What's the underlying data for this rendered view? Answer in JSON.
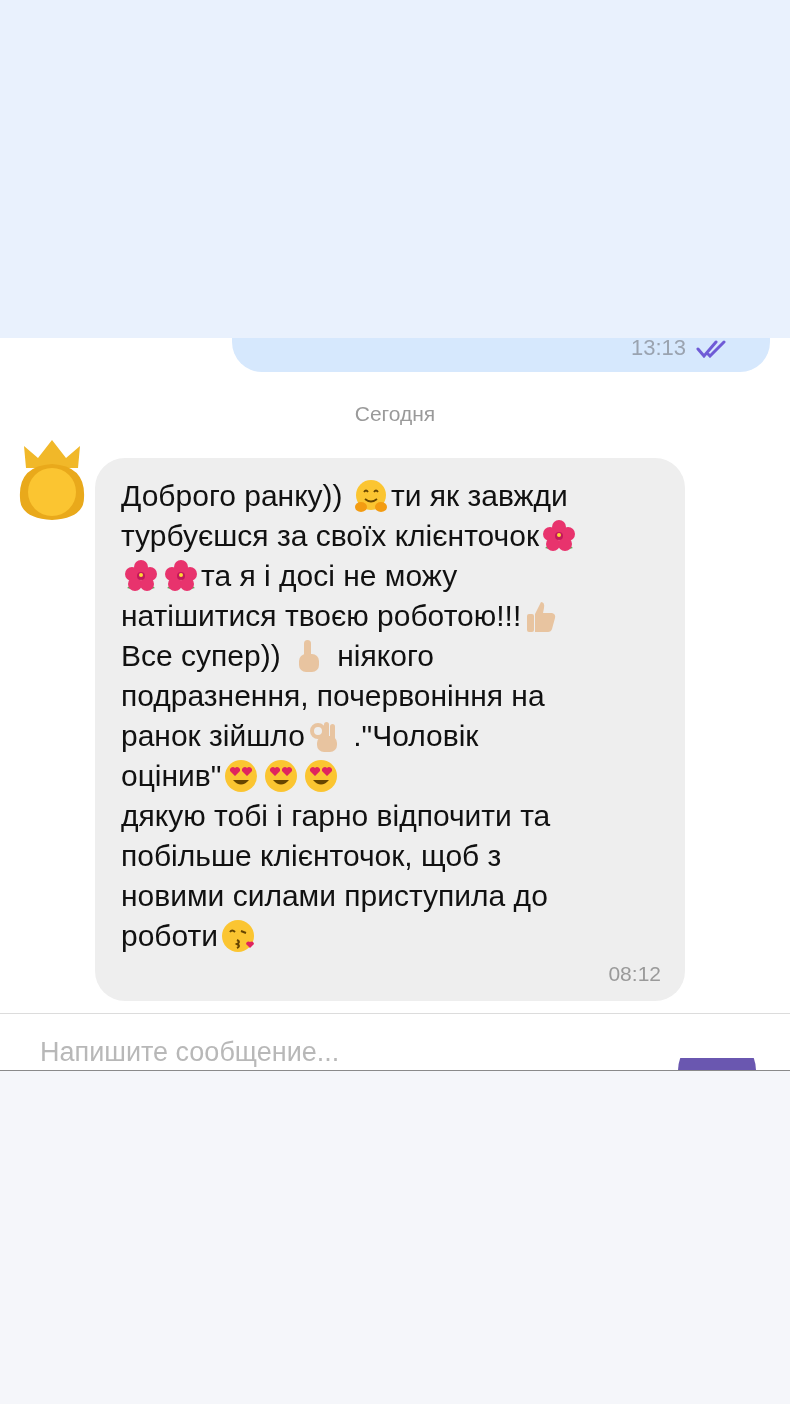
{
  "outgoing": {
    "time": "13:13",
    "read": true
  },
  "date_separator": "Сегодня",
  "incoming": {
    "time": "08:12",
    "lines": [
      [
        {
          "kind": "text",
          "text": "Доброго ранку)) "
        },
        {
          "kind": "hug"
        },
        {
          "kind": "text",
          "text": "ти як завжди"
        }
      ],
      [
        {
          "kind": "text",
          "text": "турбуєшся за своїх клієнточок"
        },
        {
          "kind": "flower"
        }
      ],
      [
        {
          "kind": "flower"
        },
        {
          "kind": "flower"
        },
        {
          "kind": "text",
          "text": "та я і досі не можу"
        }
      ],
      [
        {
          "kind": "text",
          "text": "натішитися твоєю роботою!!!"
        },
        {
          "kind": "thumb"
        }
      ],
      [
        {
          "kind": "text",
          "text": "Все супер)) "
        },
        {
          "kind": "point"
        },
        {
          "kind": "text",
          "text": " ніякого"
        }
      ],
      [
        {
          "kind": "text",
          "text": "подразнення, почервоніння на"
        }
      ],
      [
        {
          "kind": "text",
          "text": "ранок зійшло"
        },
        {
          "kind": "ok"
        },
        {
          "kind": "text",
          "text": " .\"Чоловік"
        }
      ],
      [
        {
          "kind": "text",
          "text": "оцінив\""
        },
        {
          "kind": "hearteyes"
        },
        {
          "kind": "hearteyes"
        },
        {
          "kind": "hearteyes"
        }
      ],
      [
        {
          "kind": "text",
          "text": "дякую тобі і гарно відпочити та"
        }
      ],
      [
        {
          "kind": "text",
          "text": "побільше клієнточок, щоб з"
        }
      ],
      [
        {
          "kind": "text",
          "text": "новими силами приступила до"
        }
      ],
      [
        {
          "kind": "text",
          "text": "роботи"
        },
        {
          "kind": "kiss"
        }
      ]
    ]
  },
  "composer": {
    "placeholder": "Напишите сообщение..."
  }
}
